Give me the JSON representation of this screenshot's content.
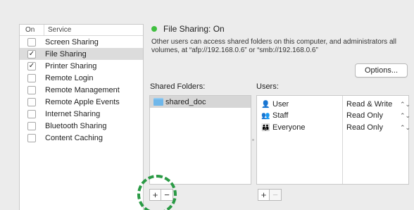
{
  "services": {
    "header_on": "On",
    "header_service": "Service",
    "items": [
      {
        "label": "Screen Sharing",
        "checked": false,
        "check_glyph": ""
      },
      {
        "label": "File Sharing",
        "checked": true,
        "check_glyph": "✓"
      },
      {
        "label": "Printer Sharing",
        "checked": true,
        "check_glyph": "✓"
      },
      {
        "label": "Remote Login",
        "checked": false,
        "check_glyph": ""
      },
      {
        "label": "Remote Management",
        "checked": false,
        "check_glyph": ""
      },
      {
        "label": "Remote Apple Events",
        "checked": false,
        "check_glyph": ""
      },
      {
        "label": "Internet Sharing",
        "checked": false,
        "check_glyph": ""
      },
      {
        "label": "Bluetooth Sharing",
        "checked": false,
        "check_glyph": ""
      },
      {
        "label": "Content Caching",
        "checked": false,
        "check_glyph": ""
      }
    ],
    "selected_index": 1
  },
  "status": {
    "text": "File Sharing: On",
    "color": "#3fbf3f",
    "description": "Other users can access shared folders on this computer, and administrators all volumes, at “afp://192.168.0.6” or “smb://192.168.0.6”"
  },
  "options_button": {
    "label": "Options..."
  },
  "shared_folders": {
    "label": "Shared Folders:",
    "items": [
      {
        "name": "shared_doc",
        "icon": "folder-icon"
      }
    ]
  },
  "users": {
    "label": "Users:",
    "items": [
      {
        "name": "User",
        "icon": "single-user-icon",
        "glyph": "👤",
        "permission": "Read & Write",
        "stepper": "⌃⌄"
      },
      {
        "name": "Staff",
        "icon": "group-icon",
        "glyph": "👥",
        "permission": "Read Only",
        "stepper": "⌃⌄"
      },
      {
        "name": "Everyone",
        "icon": "everyone-icon",
        "glyph": "👪",
        "permission": "Read Only",
        "stepper": "⌃⌄"
      }
    ]
  },
  "buttons": {
    "plus": "+",
    "minus": "−"
  },
  "highlight_color": "#2a9a45"
}
